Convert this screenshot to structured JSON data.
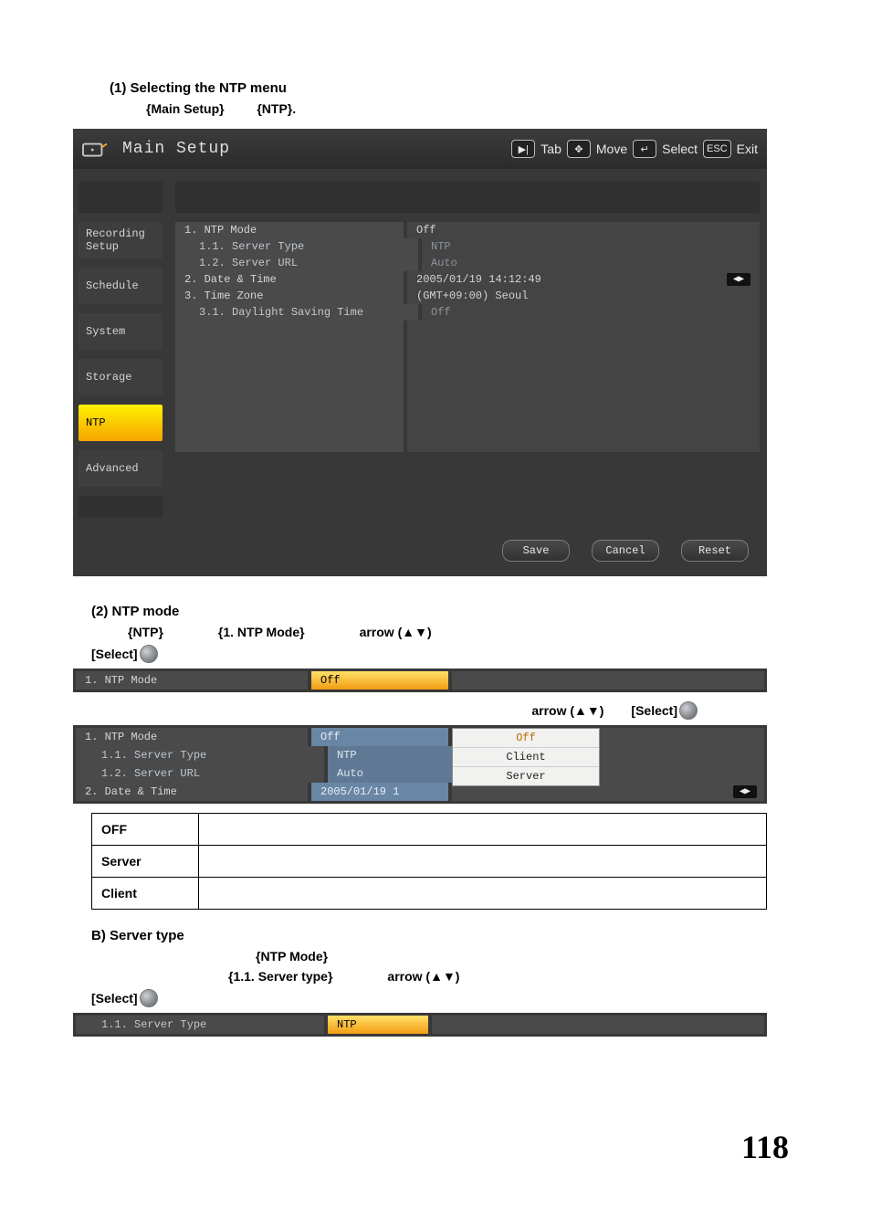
{
  "page_number": "118",
  "sectionA": {
    "heading": "(1) Selecting the NTP menu",
    "step": {
      "a": "{Main Setup}",
      "b": "{NTP}."
    }
  },
  "setup": {
    "title": "Main Setup",
    "nav": {
      "tab": "Tab",
      "move": "Move",
      "select": "Select",
      "exit": "Exit",
      "esc": "ESC"
    },
    "sidebar": [
      {
        "label": "Recording Setup",
        "selected": false,
        "id": "recording-setup"
      },
      {
        "label": "Schedule",
        "selected": false,
        "id": "schedule"
      },
      {
        "label": "System",
        "selected": false,
        "id": "system"
      },
      {
        "label": "Storage",
        "selected": false,
        "id": "storage"
      },
      {
        "label": "NTP",
        "selected": true,
        "id": "ntp"
      },
      {
        "label": "Advanced",
        "selected": false,
        "id": "advanced"
      }
    ],
    "rows": [
      {
        "label": "1. NTP Mode",
        "value": "Off",
        "sub": 0,
        "dim": false
      },
      {
        "label": "1.1. Server Type",
        "value": "NTP",
        "sub": 1,
        "dim": true
      },
      {
        "label": "1.2. Server URL",
        "value": "Auto",
        "sub": 1,
        "dim": true
      },
      {
        "label": "2. Date & Time",
        "value": "2005/01/19   14:12:49",
        "sub": 0,
        "dim": false,
        "arrows": true
      },
      {
        "label": "3. Time Zone",
        "value": "(GMT+09:00) Seoul",
        "sub": 0,
        "dim": false
      },
      {
        "label": "3.1. Daylight Saving Time",
        "value": "Off",
        "sub": 1,
        "dim": true
      }
    ],
    "buttons": {
      "save": "Save",
      "cancel": "Cancel",
      "reset": "Reset"
    }
  },
  "sectionB": {
    "heading": "(2) NTP mode",
    "line1": {
      "a": "{NTP}",
      "b": "{1. NTP Mode}",
      "c": "arrow (▲▼)"
    },
    "line2": {
      "a": "[Select]"
    },
    "strip1": {
      "label": "1. NTP Mode",
      "value": "Off"
    },
    "line3": {
      "a": "arrow (▲▼)",
      "b": "[Select]"
    },
    "strip2": {
      "rows": [
        {
          "label": "1. NTP Mode",
          "value": "Off",
          "valClass": "blue",
          "sub": 0
        },
        {
          "label": "1.1. Server Type",
          "value": "NTP",
          "valClass": "blue2",
          "sub": 1
        },
        {
          "label": "1.2. Server URL",
          "value": "Auto",
          "valClass": "blue2",
          "sub": 1
        },
        {
          "label": "2. Date & Time",
          "value": "2005/01/19  1",
          "valClass": "blue",
          "sub": 0,
          "arrows": true
        }
      ],
      "dropdown": [
        "Off",
        "Client",
        "Server"
      ]
    },
    "table": [
      {
        "k": "OFF",
        "v": ""
      },
      {
        "k": "Server",
        "v": ""
      },
      {
        "k": "Client",
        "v": ""
      }
    ]
  },
  "sectionC": {
    "heading": "B) Server type",
    "line1": {
      "a": "{NTP Mode}"
    },
    "line2": {
      "a": "{1.1. Server type}",
      "b": "arrow (▲▼)"
    },
    "line3": {
      "a": "[Select]"
    },
    "strip": {
      "label": "1.1. Server Type",
      "value": "NTP"
    }
  }
}
